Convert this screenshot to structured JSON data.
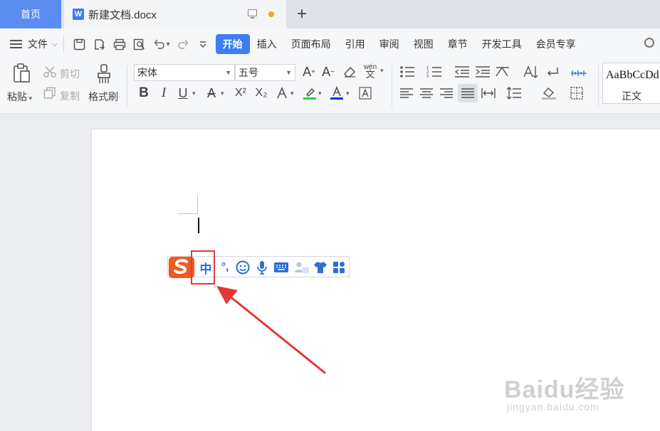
{
  "tabs": {
    "home": "首页",
    "doc_icon": "W",
    "doc_title": "新建文档.docx",
    "add": "+"
  },
  "menu": {
    "file": "文件",
    "tabs": [
      "开始",
      "插入",
      "页面布局",
      "引用",
      "审阅",
      "视图",
      "章节",
      "开发工具",
      "会员专享"
    ],
    "active_tab": "开始"
  },
  "ribbon": {
    "paste": "粘贴",
    "cut": "剪切",
    "copy": "复制",
    "format_painter": "格式刷",
    "font_name": "宋体",
    "font_size": "五号",
    "bold": "B",
    "italic": "I",
    "underline": "U",
    "superscript": "X²",
    "subscript": "X₂",
    "pinyin": "wén",
    "style_preview": "AaBbCcDd",
    "style_name": "正文"
  },
  "ime": {
    "mode": "中",
    "punct": "°,",
    "logo_letter": "S"
  },
  "watermark": {
    "brand": "Baidu经验",
    "url": "jingyan.baidu.com"
  },
  "colors": {
    "accent": "#3f7cf0",
    "home_tab": "#5a8def",
    "annotation_red": "#e53935",
    "ime_blue": "#2b6fd4",
    "ime_logo": "#f05a22"
  }
}
